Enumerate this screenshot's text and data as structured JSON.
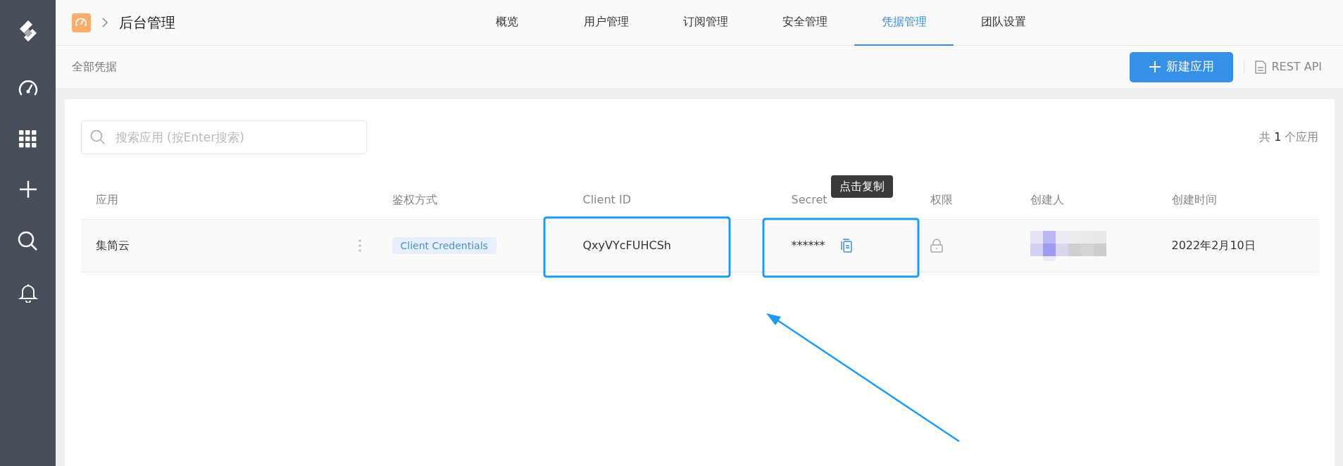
{
  "header": {
    "breadcrumb": "后台管理",
    "tabs": [
      {
        "label": "概览",
        "selected": false
      },
      {
        "label": "用户管理",
        "selected": false
      },
      {
        "label": "订阅管理",
        "selected": false
      },
      {
        "label": "安全管理",
        "selected": false
      },
      {
        "label": "凭据管理",
        "selected": true
      },
      {
        "label": "团队设置",
        "selected": false
      }
    ]
  },
  "subheader": {
    "title": "全部凭据",
    "new_button": "新建应用",
    "api_link": "REST API"
  },
  "search": {
    "placeholder": "搜索应用 (按Enter搜索)"
  },
  "count": "共 **1** 个应用",
  "table": {
    "columns": [
      "应用",
      "鉴权方式",
      "Client ID",
      "Secret",
      "权限",
      "创建人",
      "创建时间"
    ],
    "rows": [
      {
        "app": "集简云",
        "auth": "Client Credentials",
        "client_id": "QxyVYcFUHCSh",
        "secret": "******",
        "created": "2022年2月10日"
      }
    ]
  },
  "tooltip": "点击复制"
}
